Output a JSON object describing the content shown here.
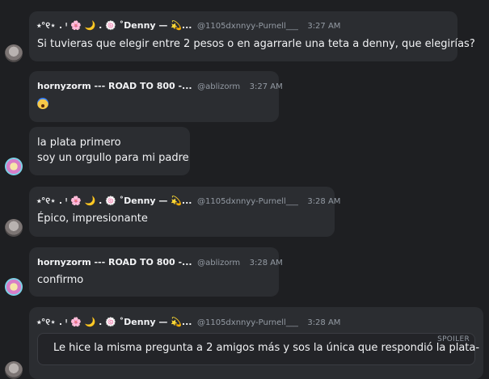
{
  "messages": [
    {
      "author": "⭑°୧⋆ . ᵎ 🌸 🌙 . 🍥 ˚Denny — 💫...",
      "handle": "@1105dxnnyy-Purnell___",
      "time": "3:27 AM",
      "lines": [
        "Si tuvieras que elegir entre 2 pesos o en agarrarle una teta a denny, que elegirías?"
      ]
    },
    {
      "author": "hornyzorm --- ROAD TO 800 -...",
      "handle": "@ablizorm",
      "time": "3:27 AM",
      "emoji": "fearful-face"
    },
    {
      "lines": [
        "la plata primero",
        "soy un orgullo para mi padre"
      ]
    },
    {
      "author": "⭑°୧⋆ . ᵎ 🌸 🌙 . 🍥 ˚Denny — 💫...",
      "handle": "@1105dxnnyy-Purnell___",
      "time": "3:28 AM",
      "lines": [
        "Épico, impresionante"
      ]
    },
    {
      "author": "hornyzorm --- ROAD TO 800 -...",
      "handle": "@ablizorm",
      "time": "3:28 AM",
      "lines": [
        "confirmo"
      ]
    },
    {
      "author": "⭑°୧⋆ . ᵎ 🌸 🌙 . 🍥 ˚Denny — 💫...",
      "handle": "@1105dxnnyy-Purnell___",
      "time": "3:28 AM",
      "spoiler_label": "SPOILER",
      "spoiler_text": "Le hice la misma pregunta a 2 amigos más y sos la única que respondió la plata-"
    }
  ]
}
